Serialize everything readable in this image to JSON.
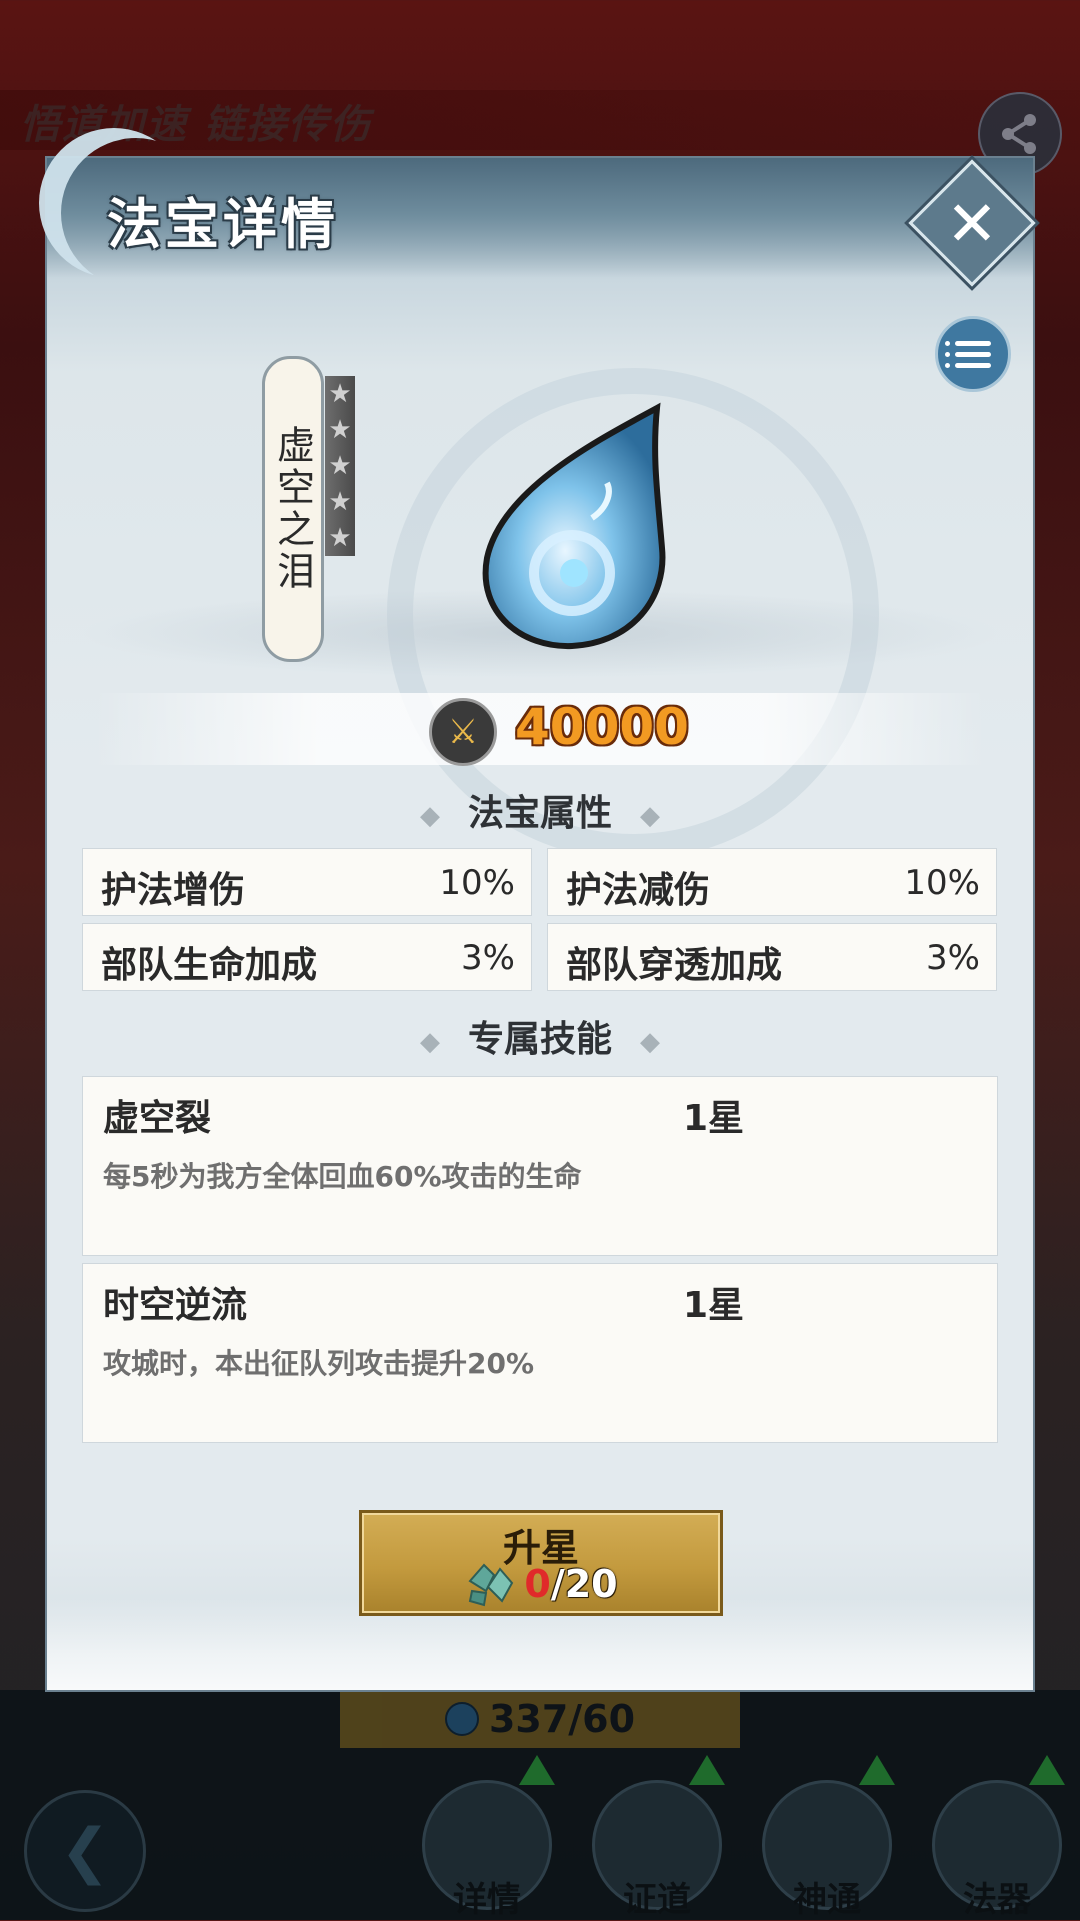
{
  "background": {
    "banner_text": "悟道加速 链接传伤",
    "cost_value": "337/60",
    "tabs": [
      {
        "label": "详情"
      },
      {
        "label": "证道"
      },
      {
        "label": "神通"
      },
      {
        "label": "法器"
      }
    ]
  },
  "dialog": {
    "title": "法宝详情",
    "treasure_name": "虚空之泪",
    "stars_total": 5,
    "power": "40000",
    "attributes_title": "法宝属性",
    "attributes": [
      {
        "name": "护法增伤",
        "value": "10%"
      },
      {
        "name": "护法减伤",
        "value": "10%"
      },
      {
        "name": "部队生命加成",
        "value": "3%"
      },
      {
        "name": "部队穿透加成",
        "value": "3%"
      }
    ],
    "skills_title": "专属技能",
    "skills": [
      {
        "name": "虚空裂",
        "level": "1星",
        "desc": "每5秒为我方全体回血60%攻击的生命"
      },
      {
        "name": "时空逆流",
        "level": "1星",
        "desc": "攻城时，本出征队列攻击提升20%"
      }
    ],
    "upgrade": {
      "label": "升星",
      "have": "0",
      "need": "/20"
    }
  },
  "colors": {
    "accent_gold": "#c39a3e",
    "power_orange": "#f29a22",
    "insufficient_red": "#e02a2a",
    "menu_blue": "#3f78a0"
  },
  "icons": {
    "share": "share-icon",
    "close": "close-icon",
    "menu": "list-menu-icon",
    "power": "sword-power-icon",
    "material": "jade-fragment-icon",
    "treasure": "water-drop-icon"
  }
}
